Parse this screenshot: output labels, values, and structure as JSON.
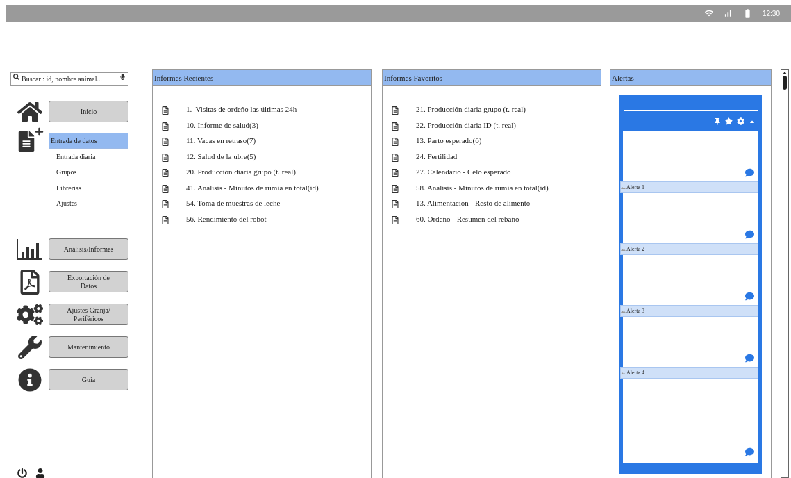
{
  "status_bar": {
    "time": "12:30"
  },
  "search": {
    "placeholder": "Buscar : id, nombre animal..."
  },
  "nav": [
    {
      "kind": "button",
      "label": "Inicio"
    },
    {
      "kind": "menu",
      "label": "Entrada de datos",
      "selected": true,
      "items": [
        {
          "label": "Entrada diaria",
          "selected": false
        },
        {
          "label": "Grupos",
          "selected": false
        },
        {
          "label": "Librerias",
          "selected": false
        },
        {
          "label": "Ajustes",
          "selected": false
        }
      ]
    },
    {
      "kind": "button",
      "label": "Análisis/Informes"
    },
    {
      "kind": "button",
      "label": "Exportación de Datos"
    },
    {
      "kind": "button",
      "label": "Ajustes Granja/ Periféricos"
    },
    {
      "kind": "button",
      "label": "Mantenimiento"
    },
    {
      "kind": "button",
      "label": "Guia"
    }
  ],
  "recent_reports": {
    "title": "Informes Recientes",
    "items": [
      "1.  Visitas de ordeño las últimas 24h",
      "10. Informe de salud(3)",
      "11. Vacas en retraso(7)",
      "12. Salud de la ubre(5)",
      "20. Producción diaria grupo (t. real)",
      "41. Análisis - Minutos de rumia en total(id)",
      "54. Toma de muestras de leche",
      "56. Rendimiento del robot"
    ]
  },
  "favorite_reports": {
    "title": "Informes Favoritos",
    "items": [
      "21. Producción diaria grupo (t. real)",
      "22. Producción diaria ID (t. real)",
      "13. Parto esperado(6)",
      "24. Fertilidad",
      "27. Calendario - Celo esperado",
      "58. Análisis - Minutos de rumia en total(id)",
      "13. Alimentación - Resto de alimento",
      "60. Ordeño - Resumen del rebaño"
    ]
  },
  "alerts": {
    "title": "Alertas",
    "items": [
      "Alerta 1",
      "Alerta 2",
      "Alerta 3",
      "Alerta 4"
    ]
  }
}
